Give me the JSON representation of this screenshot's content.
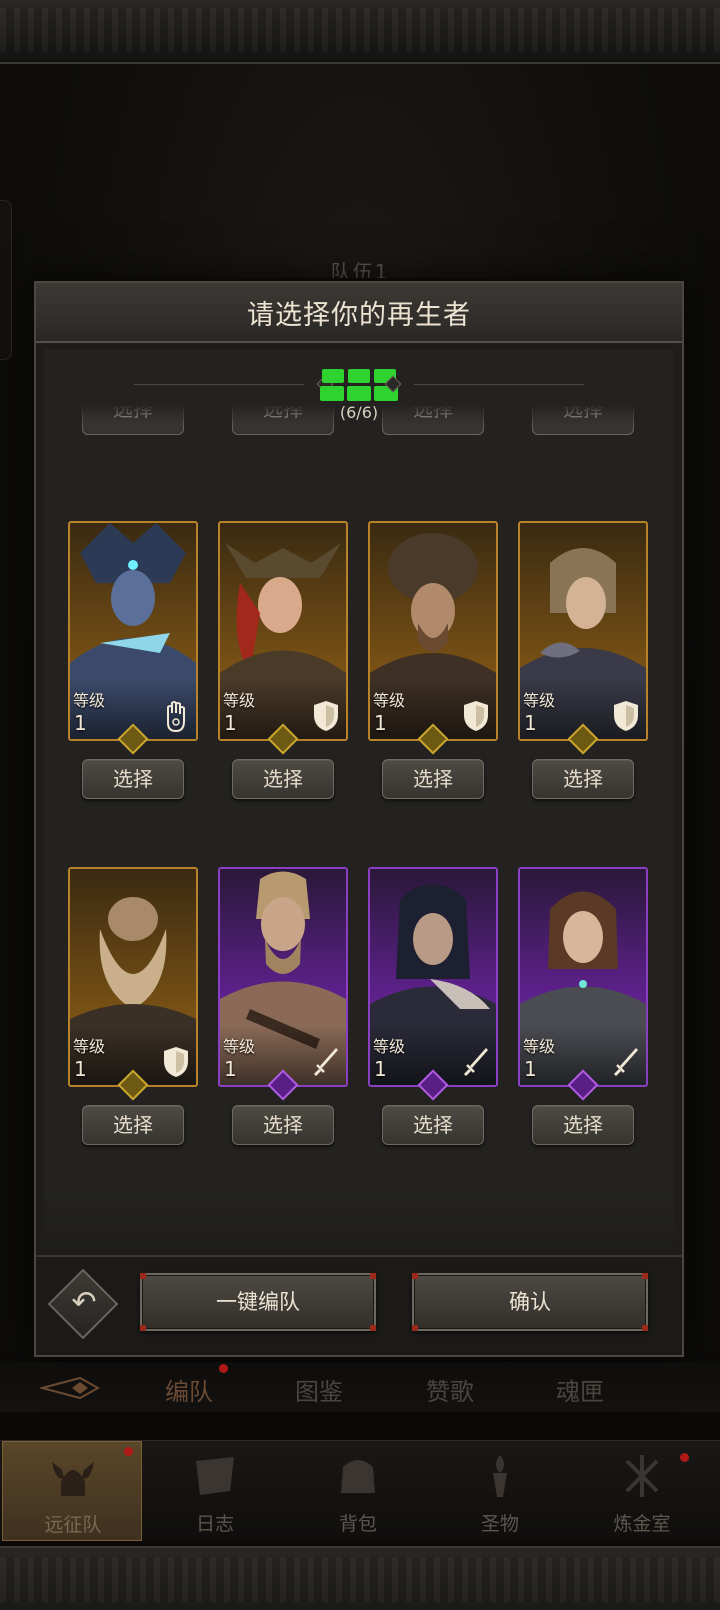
{
  "background": {
    "team_label": "队伍1"
  },
  "dialog": {
    "title": "请选择你的再生者",
    "counter": "(6/6)",
    "partial_row_label": "选择",
    "level_label": "等级",
    "select_label": "选择",
    "heroes": [
      {
        "level": "1",
        "rarity": "gold",
        "class_icon": "hand-palm-icon"
      },
      {
        "level": "1",
        "rarity": "gold",
        "class_icon": "shield-icon"
      },
      {
        "level": "1",
        "rarity": "gold",
        "class_icon": "shield-icon"
      },
      {
        "level": "1",
        "rarity": "gold",
        "class_icon": "shield-icon"
      },
      {
        "level": "1",
        "rarity": "gold",
        "class_icon": "shield-icon"
      },
      {
        "level": "1",
        "rarity": "purple",
        "class_icon": "sword-icon"
      },
      {
        "level": "1",
        "rarity": "purple",
        "class_icon": "sword-icon"
      },
      {
        "level": "1",
        "rarity": "purple",
        "class_icon": "sword-icon"
      }
    ],
    "footer": {
      "auto_team": "一键编队",
      "confirm": "确认"
    }
  },
  "sub_tabs": [
    "编队",
    "图鉴",
    "赞歌",
    "魂匣"
  ],
  "bottom_nav": [
    "远征队",
    "日志",
    "背包",
    "圣物",
    "炼金室"
  ],
  "colors": {
    "gold_card": "#b88328",
    "purple_card": "#8a3fc2",
    "slot_green": "#2fd32f",
    "notify_red": "#b01a16"
  }
}
